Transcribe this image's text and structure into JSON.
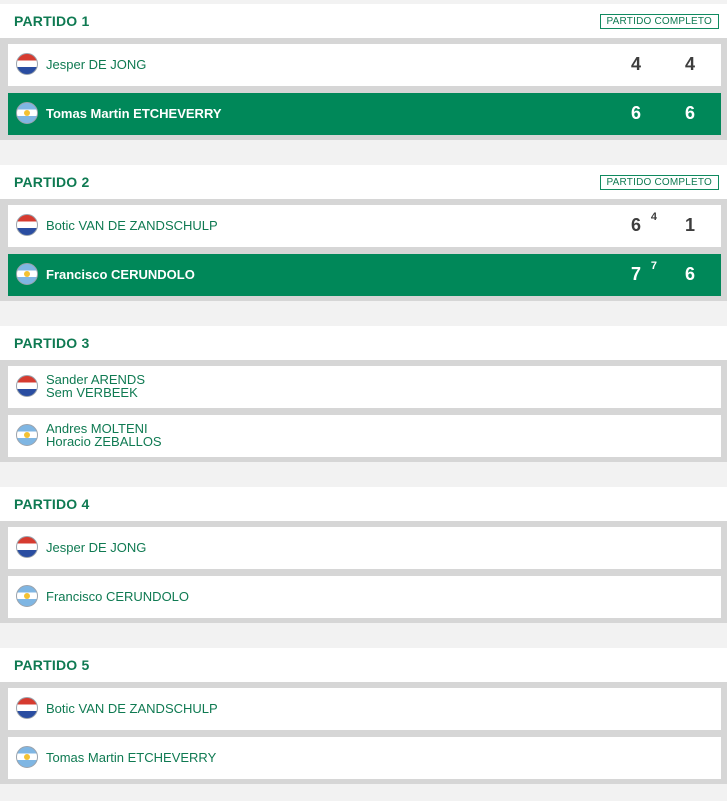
{
  "matches": [
    {
      "title": "PARTIDO 1",
      "status": "PARTIDO COMPLETO",
      "players": [
        {
          "names": [
            "Jesper DE JONG"
          ],
          "flag": "netherlands-flag",
          "sets": [
            "4",
            "4"
          ]
        },
        {
          "names": [
            "Tomas Martin ETCHEVERRY"
          ],
          "flag": "argentina-flag",
          "sets": [
            "6",
            "6"
          ],
          "winner": true
        }
      ]
    },
    {
      "title": "PARTIDO 2",
      "status": "PARTIDO COMPLETO",
      "players": [
        {
          "names": [
            "Botic VAN DE ZANDSCHULP"
          ],
          "flag": "netherlands-flag",
          "sets": [
            "6",
            "1"
          ],
          "tiebreak": [
            "4",
            ""
          ]
        },
        {
          "names": [
            "Francisco CERUNDOLO"
          ],
          "flag": "argentina-flag",
          "sets": [
            "7",
            "6"
          ],
          "tiebreak": [
            "7",
            ""
          ],
          "winner": true
        }
      ]
    },
    {
      "title": "PARTIDO 3",
      "status": "",
      "players": [
        {
          "names": [
            "Sander ARENDS",
            "Sem VERBEEK"
          ],
          "flag": "netherlands-flag"
        },
        {
          "names": [
            "Andres MOLTENI",
            "Horacio ZEBALLOS"
          ],
          "flag": "argentina-flag"
        }
      ]
    },
    {
      "title": "PARTIDO 4",
      "status": "",
      "players": [
        {
          "names": [
            "Jesper DE JONG"
          ],
          "flag": "netherlands-flag"
        },
        {
          "names": [
            "Francisco CERUNDOLO"
          ],
          "flag": "argentina-flag"
        }
      ]
    },
    {
      "title": "PARTIDO 5",
      "status": "",
      "players": [
        {
          "names": [
            "Botic VAN DE ZANDSCHULP"
          ],
          "flag": "netherlands-flag"
        },
        {
          "names": [
            "Tomas Martin ETCHEVERRY"
          ],
          "flag": "argentina-flag"
        }
      ]
    }
  ],
  "colors": {
    "accent": "#008859",
    "title": "#0f7a52"
  }
}
